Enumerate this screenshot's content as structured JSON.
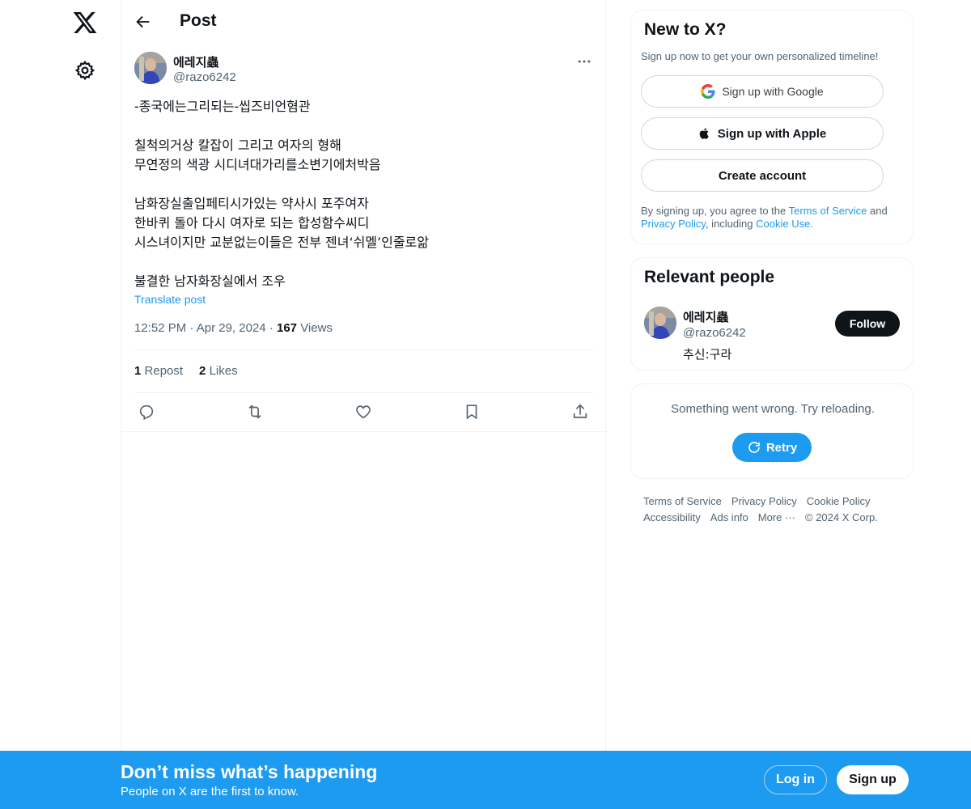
{
  "nav": {
    "logo_icon": "x-logo-icon",
    "settings_icon": "gear-icon"
  },
  "header": {
    "title": "Post",
    "back_icon": "back-arrow-icon"
  },
  "post": {
    "author_name": "에레지蟲",
    "author_handle": "@razo6242",
    "body_lines": [
      "-종국에는그리되는-씹즈비언혐관",
      "",
      "칠척의거상 칼잡이 그리고 여자의 형해",
      "무연정의 색광 시디녀대가리를소변기에처박음",
      "",
      "남화장실출입페티시가있는 약사시 포주여자",
      "한바퀴 돌아 다시 여자로 되는 합성함수씨디",
      "시스녀이지만 교분없는이들은 전부 젠녀‘쉬멜’인줄로앎",
      "",
      "불결한 남자화장실에서 조우"
    ],
    "translate_label": "Translate post",
    "time": "12:52 PM",
    "date": "Apr 29, 2024",
    "views_count": "167",
    "views_label": "Views",
    "reposts_count": "1",
    "reposts_label": "Repost",
    "likes_count": "2",
    "likes_label": "Likes"
  },
  "signup_card": {
    "title": "New to X?",
    "subtitle": "Sign up now to get your own personalized timeline!",
    "google_label": "Sign up with Google",
    "apple_label": "Sign up with Apple",
    "create_label": "Create account",
    "legal_prefix": "By signing up, you agree to the ",
    "terms_link": "Terms of Service",
    "legal_and": " and ",
    "privacy_link": "Privacy Policy",
    "legal_including": ", including ",
    "cookie_link": "Cookie Use."
  },
  "relevant_people": {
    "title": "Relevant people",
    "name": "에레지蟲",
    "handle": "@razo6242",
    "bio": "추신:구라",
    "follow_label": "Follow"
  },
  "error_card": {
    "message": "Something went wrong. Try reloading.",
    "retry_label": "Retry"
  },
  "footer": {
    "links": [
      "Terms of Service",
      "Privacy Policy",
      "Cookie Policy",
      "Accessibility",
      "Ads info",
      "More ···",
      "© 2024 X Corp."
    ]
  },
  "banner": {
    "title": "Don’t miss what’s happening",
    "subtitle": "People on X are the first to know.",
    "login_label": "Log in",
    "signup_label": "Sign up"
  },
  "colors": {
    "accent": "#1d9bf0",
    "text": "#0f1419",
    "muted": "#536471",
    "border": "#eff3f4"
  }
}
